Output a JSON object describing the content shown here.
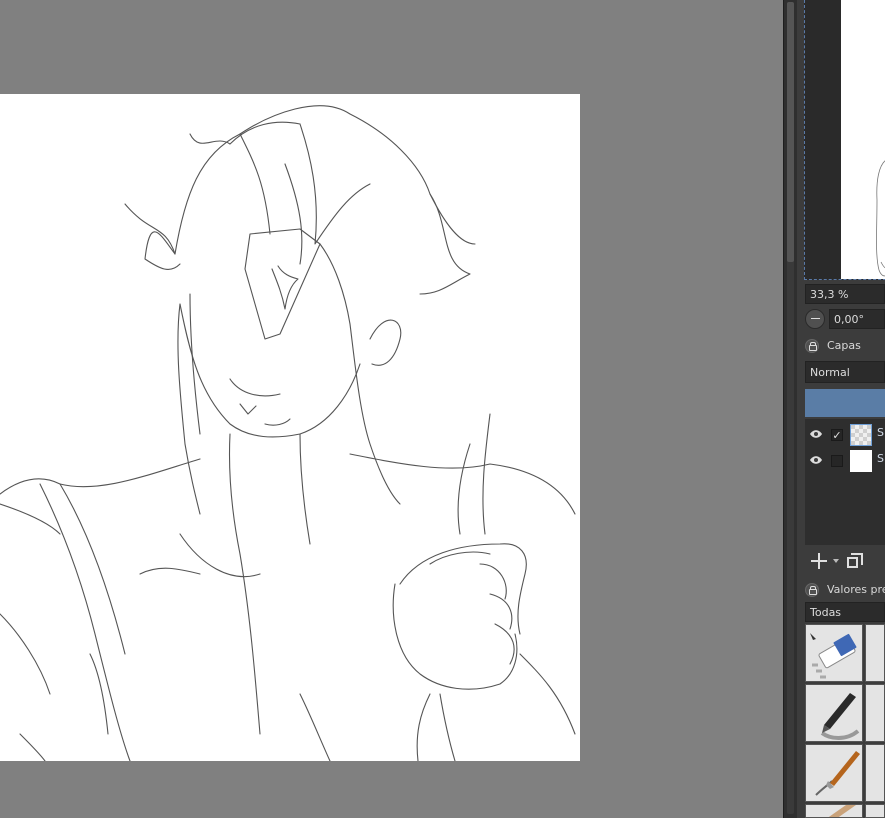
{
  "canvas": {
    "background_color": "#808080",
    "paper_color": "#ffffff",
    "sketch_color": "#555555"
  },
  "overview": {
    "frame_color": "#5a7aa8"
  },
  "view": {
    "zoom": "33,3 %",
    "rotation": "0,00°"
  },
  "layers": {
    "title": "Capas",
    "blend_mode": "Normal",
    "selected_color": "#5a7da6",
    "items": [
      {
        "name": "S",
        "visible": true,
        "checked": "✓"
      },
      {
        "name": "S",
        "visible": true,
        "checked": ""
      }
    ]
  },
  "presets": {
    "title": "Valores pre",
    "filter": "Todas",
    "brushes": [
      {
        "icon": "eraser-brush-icon"
      },
      {
        "icon": "ink-pen-brush-icon"
      },
      {
        "icon": "paint-brush-icon"
      },
      {
        "icon": "pencil-brush-icon"
      }
    ]
  }
}
